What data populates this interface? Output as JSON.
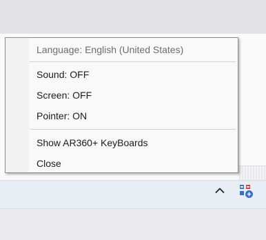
{
  "menu": {
    "header": "Language: English (United States)",
    "items": [
      {
        "label": "Sound: OFF"
      },
      {
        "label": "Screen: OFF"
      },
      {
        "label": "Pointer: ON"
      },
      {
        "label": "Show AR360+ KeyBoards"
      },
      {
        "label": "Close"
      }
    ]
  },
  "tray": {
    "chevron_icon": "chevron-up-icon",
    "app_icon": "ar360-keyboard-tray-icon"
  },
  "colors": {
    "tray_icon_blue": "#2f6fd8",
    "tray_icon_red": "#e13b33",
    "taskbar": "#e9eef5"
  }
}
